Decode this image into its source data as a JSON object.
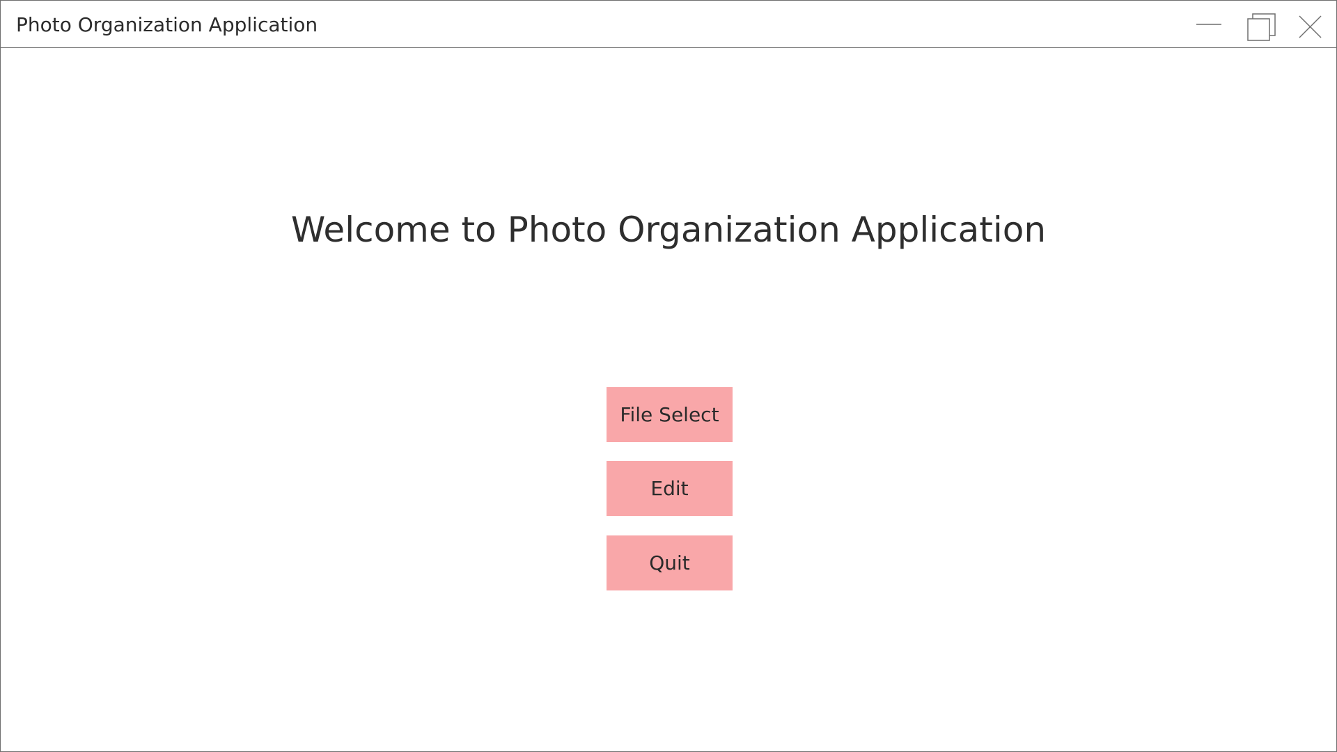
{
  "window": {
    "title": "Photo Organization Application",
    "controls": {
      "minimize": "minimize-icon",
      "maximize": "restore-icon",
      "close": "close-icon"
    }
  },
  "main": {
    "welcome_text": "Welcome to Photo Organization Application",
    "buttons": {
      "file_select": "File Select",
      "edit": "Edit",
      "quit": "Quit"
    }
  },
  "colors": {
    "button_background": "#f9a7a9",
    "text": "#2e2e2e",
    "window_border": "#6e6e6e"
  }
}
